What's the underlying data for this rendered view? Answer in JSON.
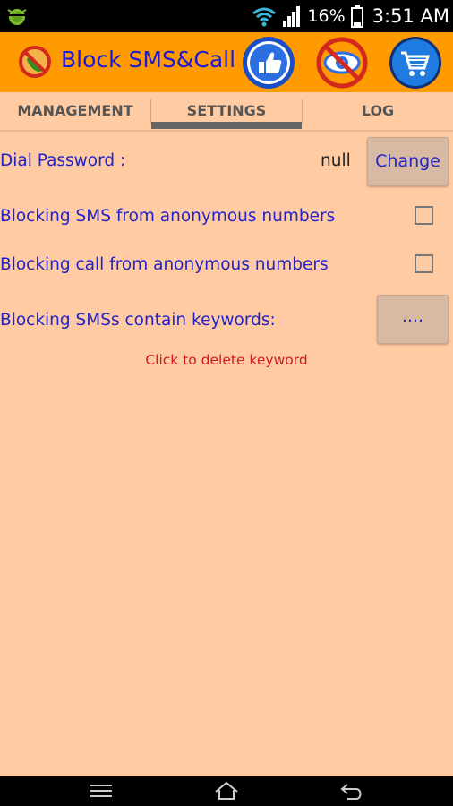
{
  "status_bar": {
    "battery_percent": "16%",
    "time": "3:51 AM"
  },
  "header": {
    "title": "Block SMS&Call",
    "icons": [
      "app-logo-icon",
      "thumbs-up-icon",
      "privacy-eye-icon",
      "shopping-cart-icon"
    ]
  },
  "tabs": [
    {
      "label": "MANAGEMENT",
      "selected": false
    },
    {
      "label": "SETTINGS",
      "selected": true
    },
    {
      "label": "LOG",
      "selected": false
    }
  ],
  "settings": {
    "dial_password_label": "Dial Password :",
    "dial_password_value": "null",
    "change_button": "Change",
    "block_sms_anonymous": {
      "label": "Blocking SMS from anonymous numbers",
      "checked": false
    },
    "block_call_anonymous": {
      "label": "Blocking call from anonymous numbers",
      "checked": false
    },
    "keywords_label": "Blocking SMSs contain keywords:",
    "keywords_button": "....",
    "keyword_hint": "Click to delete keyword"
  },
  "colors": {
    "header_bg": "#FF9A00",
    "content_bg": "#FFCBA3",
    "title_color": "#1a1ad8",
    "hint_color": "#d11c1c"
  }
}
